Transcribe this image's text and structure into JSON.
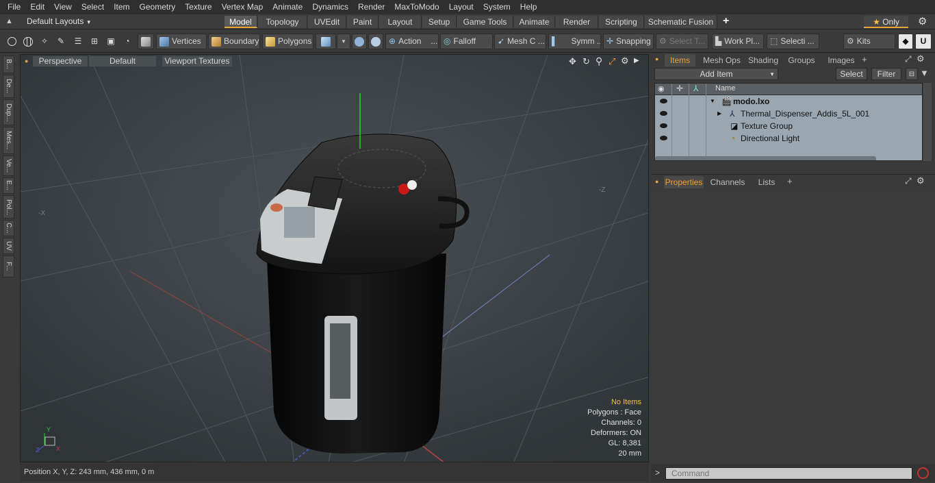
{
  "menu": [
    "File",
    "Edit",
    "View",
    "Select",
    "Item",
    "Geometry",
    "Texture",
    "Vertex Map",
    "Animate",
    "Dynamics",
    "Render",
    "MaxToModo",
    "Layout",
    "System",
    "Help"
  ],
  "layoutbar": {
    "layouts_label": "Default Layouts",
    "tabs": [
      "Model",
      "Topology",
      "UVEdit",
      "Paint",
      "Layout",
      "Setup",
      "Game Tools",
      "Animate",
      "Render",
      "Scripting",
      "Schematic Fusion"
    ],
    "active_tab": "Model",
    "add_label": "+",
    "only_label": "Only"
  },
  "toolbar": {
    "vertices": "Vertices",
    "boundary": "Boundary",
    "polygons": "Polygons",
    "action": "Action",
    "action_more": "...",
    "falloff": "Falloff",
    "mesh": "Mesh C ...",
    "symm": "Symm ...",
    "snapping": "Snapping",
    "select_t": "Select T...",
    "work_pl": "Work Pl...",
    "selecti": "Selecti ...",
    "kits": "Kits"
  },
  "left_tabs": [
    "B...",
    "De...",
    "Dup...",
    "Mes...",
    "Ve...",
    "E...",
    "Pol...",
    "C...",
    "UV",
    "F..."
  ],
  "viewport": {
    "perspective": "Perspective",
    "default": "Default",
    "textures": "Viewport Textures",
    "hud": {
      "no_items": "No Items",
      "polygons": "Polygons : Face",
      "channels": "Channels: 0",
      "deformers": "Deformers: ON",
      "gl": "GL: 8,381",
      "scale": "20 mm"
    },
    "axis_x": "X",
    "axis_y": "Y",
    "axis_z": "Z"
  },
  "status": {
    "position": "Position X, Y, Z:   243 mm, 436 mm, 0 m"
  },
  "items_panel": {
    "tabs": [
      "Items",
      "Mesh Ops",
      "Shading",
      "Groups",
      "Images"
    ],
    "active_tab": "Items",
    "add_item": "Add Item",
    "select": "Select",
    "filter": "Filter",
    "name_header": "Name",
    "rows": [
      {
        "label": "modo.lxo"
      },
      {
        "label": "Thermal_Dispenser_Addis_5L_001"
      },
      {
        "label": "Texture Group"
      },
      {
        "label": "Directional Light"
      }
    ]
  },
  "properties_panel": {
    "tabs": [
      "Properties",
      "Channels",
      "Lists"
    ],
    "active_tab": "Properties"
  },
  "command": {
    "placeholder": "Command"
  },
  "colors": {
    "accent": "#f0a030",
    "viewport_bg": "#3d4347",
    "item_list_bg": "#9aa7b0"
  }
}
